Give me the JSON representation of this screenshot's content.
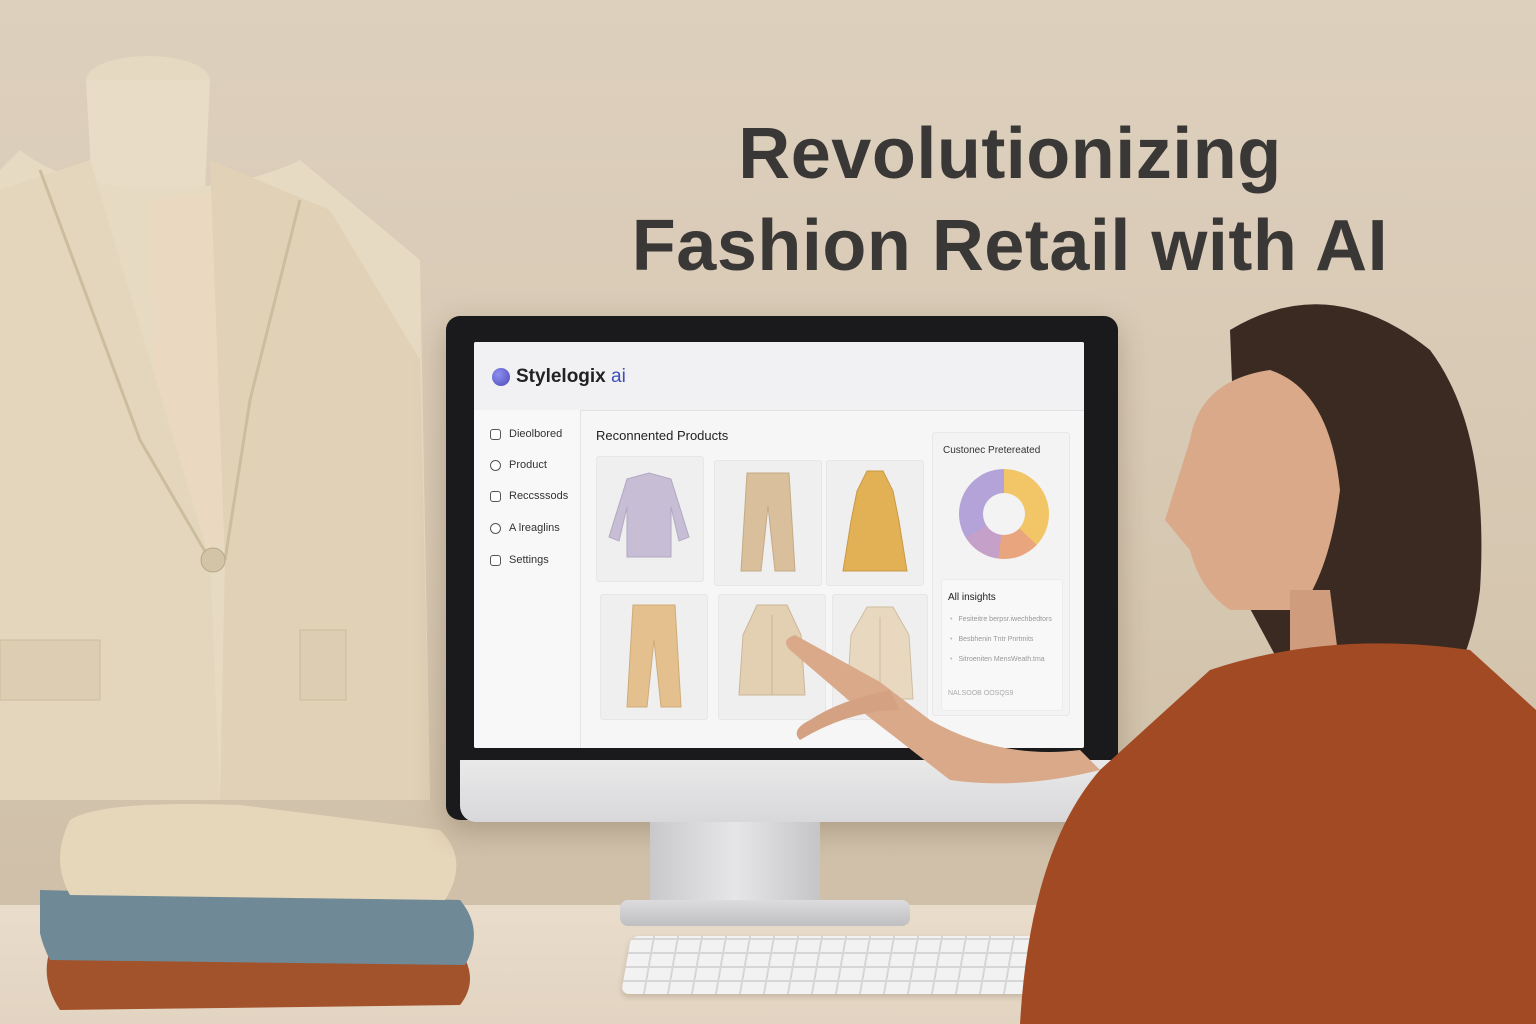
{
  "headline": {
    "line1": "Revolutionizing",
    "line2": "Fashion Retail with AI"
  },
  "app": {
    "brand_name": "Stylelogix",
    "brand_suffix": "ai",
    "brand_color": "#3b4fb8"
  },
  "sidebar": {
    "items": [
      {
        "label": "Dieolbored",
        "icon": "dashboard-icon"
      },
      {
        "label": "Product",
        "icon": "product-icon"
      },
      {
        "label": "Reccsssods",
        "icon": "records-icon"
      },
      {
        "label": "A lreaglins",
        "icon": "analytics-icon"
      },
      {
        "label": "Settings",
        "icon": "settings-icon"
      }
    ]
  },
  "main": {
    "title": "Reconnented Products",
    "products": [
      {
        "item": "sweater",
        "color": "#c7bdd4"
      },
      {
        "item": "trousers",
        "color": "#d9bf9b"
      },
      {
        "item": "dress",
        "color": "#e2b055"
      },
      {
        "item": "trousers",
        "color": "#e3c08e"
      },
      {
        "item": "long coat",
        "color": "#e3cfb2"
      },
      {
        "item": "trench coat",
        "color": "#e8d8bf"
      }
    ]
  },
  "panel": {
    "title": "Custonec Pretereated",
    "donut_colors": [
      "#f2c566",
      "#e9a57e",
      "#c5a0c8",
      "#b3a3d8"
    ],
    "insights_title": "All insights",
    "insights": [
      "Fesiteitre berpsr.iwechbedtors",
      "Besbhenin Tntr Pnrtmits",
      "Sitroeniten MensWeath.tma"
    ],
    "footer": "NALSOOB OOSQS9"
  }
}
